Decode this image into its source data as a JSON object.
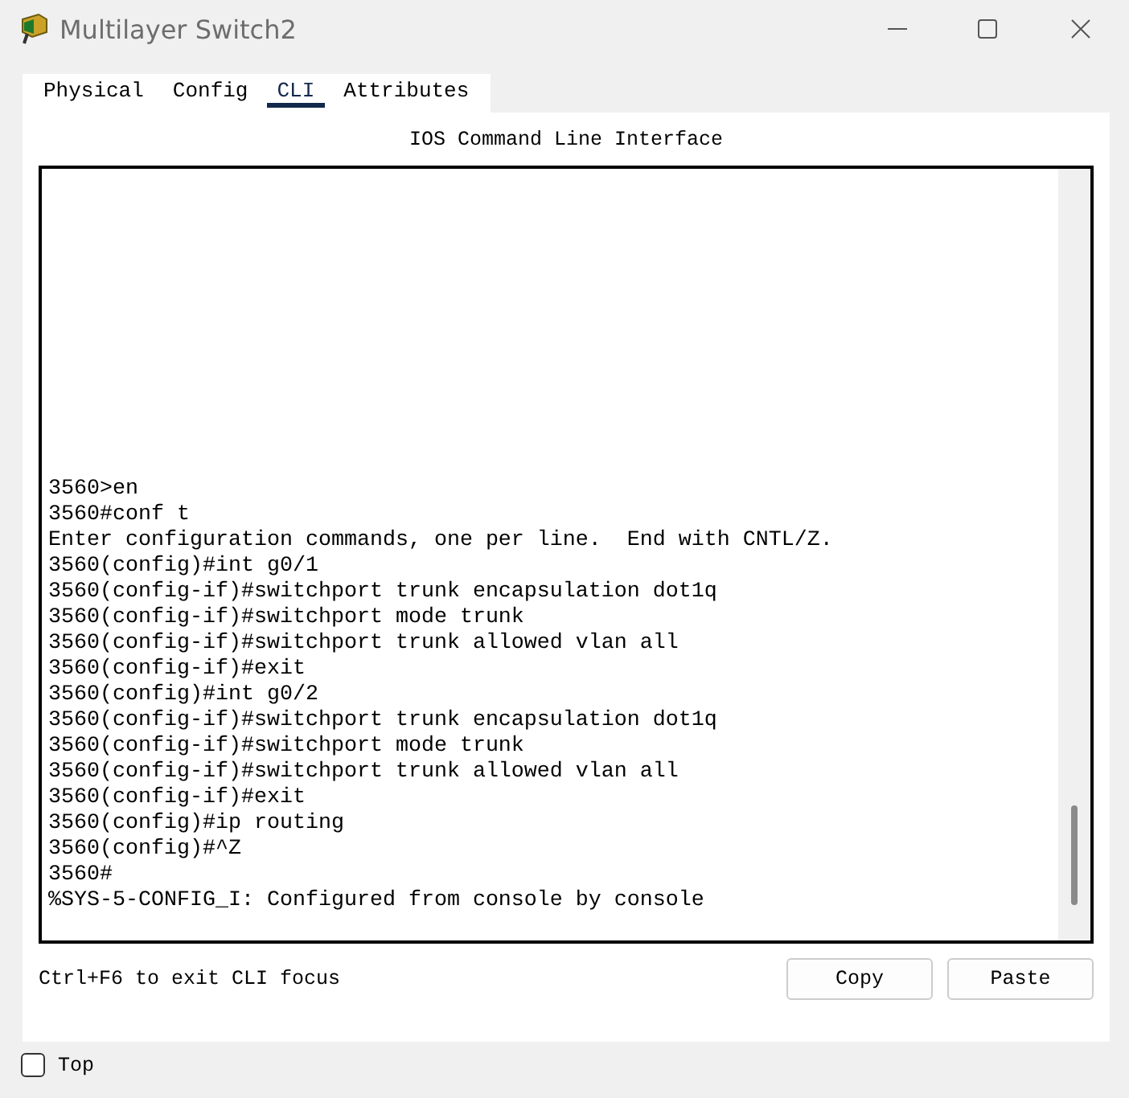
{
  "window": {
    "title": "Multilayer Switch2"
  },
  "tabs": [
    {
      "label": "Physical",
      "selected": false
    },
    {
      "label": "Config",
      "selected": false
    },
    {
      "label": "CLI",
      "selected": true
    },
    {
      "label": "Attributes",
      "selected": false
    }
  ],
  "panel_title": "IOS Command Line Interface",
  "terminal_lines": [
    "3560>en",
    "3560#conf t",
    "Enter configuration commands, one per line.  End with CNTL/Z.",
    "3560(config)#int g0/1",
    "3560(config-if)#switchport trunk encapsulation dot1q",
    "3560(config-if)#switchport mode trunk",
    "3560(config-if)#switchport trunk allowed vlan all",
    "3560(config-if)#exit",
    "3560(config)#int g0/2",
    "3560(config-if)#switchport trunk encapsulation dot1q",
    "3560(config-if)#switchport mode trunk",
    "3560(config-if)#switchport trunk allowed vlan all",
    "3560(config-if)#exit",
    "3560(config)#ip routing",
    "3560(config)#^Z",
    "3560#",
    "%SYS-5-CONFIG_I: Configured from console by console"
  ],
  "hint": "Ctrl+F6 to exit CLI focus",
  "buttons": [
    "Copy",
    "Paste"
  ],
  "top_checkbox": {
    "label": "Top",
    "checked": false
  }
}
